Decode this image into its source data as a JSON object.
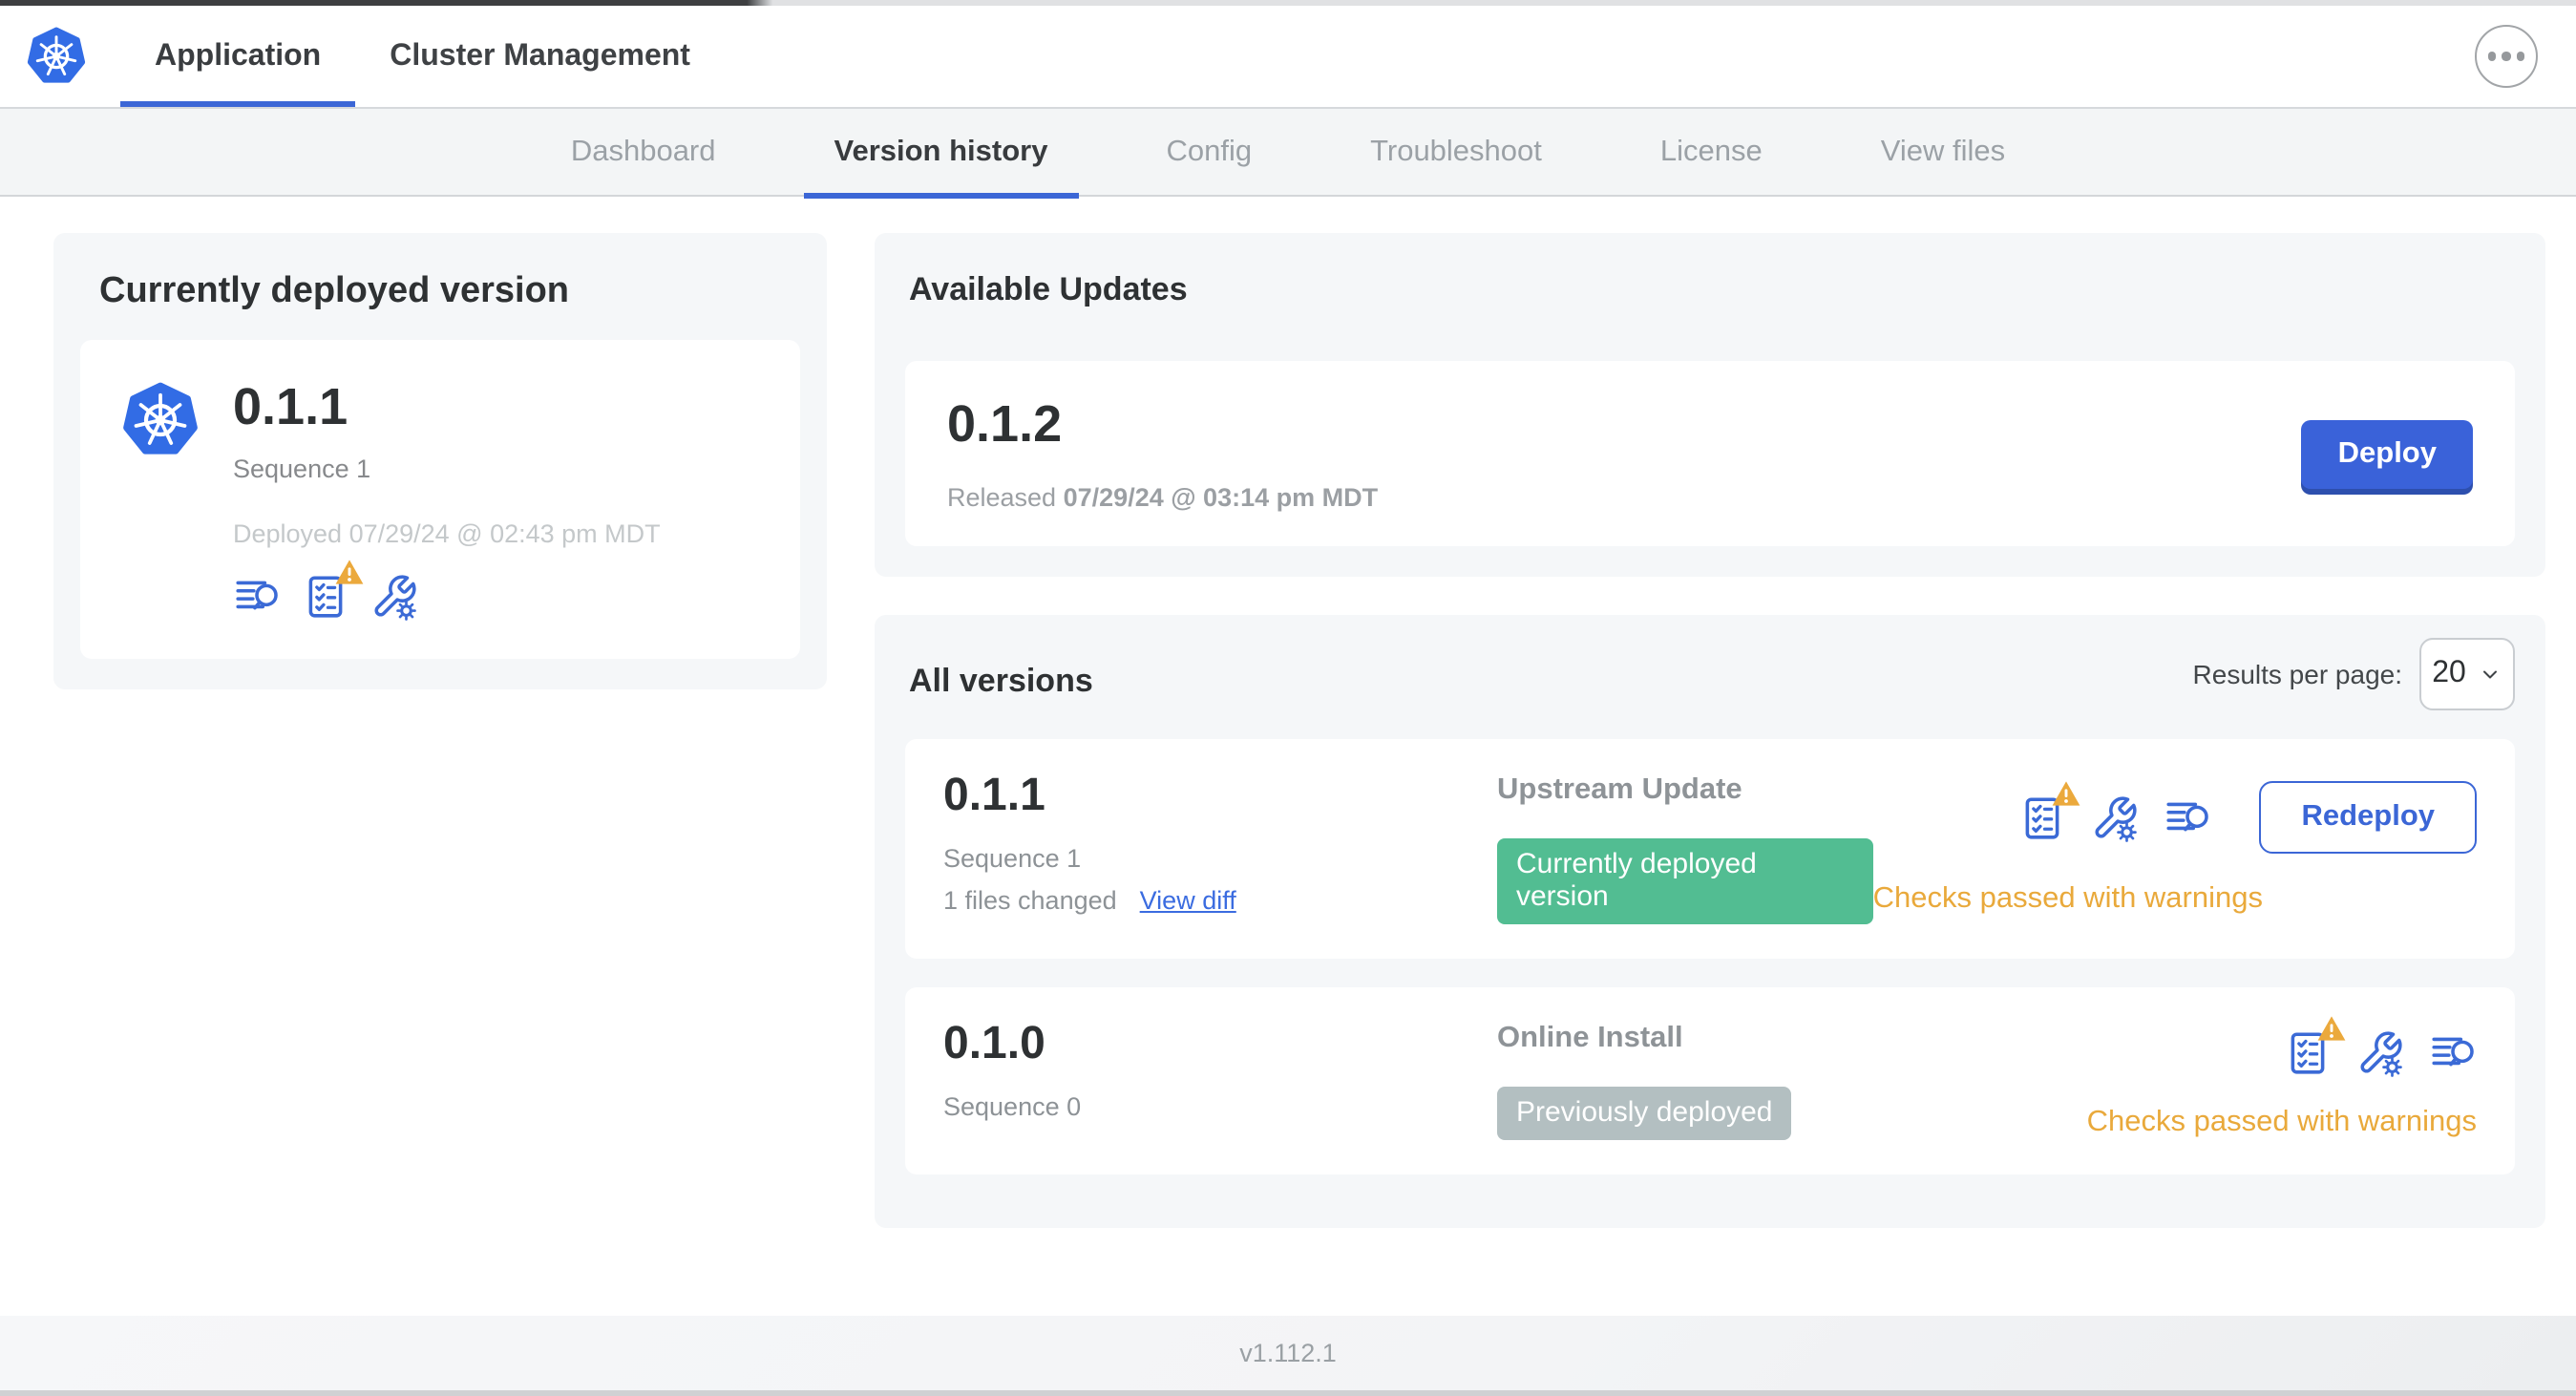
{
  "top_nav": {
    "tabs": [
      {
        "label": "Application",
        "active": true
      },
      {
        "label": "Cluster Management",
        "active": false
      }
    ],
    "more_menu_icon": "ellipsis-icon"
  },
  "sub_nav": {
    "tabs": [
      "Dashboard",
      "Version history",
      "Config",
      "Troubleshoot",
      "License",
      "View files"
    ],
    "active_tab": "Version history"
  },
  "currently_deployed": {
    "title": "Currently deployed version",
    "version": "0.1.1",
    "sequence": "Sequence 1",
    "deployed_at": "Deployed 07/29/24 @ 02:43 pm MDT",
    "icons": [
      "logs-search-icon",
      "preflight-checks-warning-icon",
      "config-tools-icon"
    ]
  },
  "available_updates": {
    "title": "Available Updates",
    "version": "0.1.2",
    "released_prefix": "Released",
    "released_at": "07/29/24 @ 03:14 pm MDT",
    "deploy_label": "Deploy"
  },
  "all_versions": {
    "title": "All versions",
    "results_per_page_label": "Results per page:",
    "results_per_page_value": "20",
    "rows": [
      {
        "version": "0.1.1",
        "sequence": "Sequence 1",
        "files_changed": "1 files changed",
        "view_diff_label": "View diff",
        "source": "Upstream Update",
        "badge": "Currently deployed version",
        "badge_color": "#52bd92",
        "checks_status": "Checks passed with warnings",
        "action_label": "Redeploy",
        "icons": [
          "preflight-checks-warning-icon",
          "config-tools-icon",
          "logs-search-icon"
        ]
      },
      {
        "version": "0.1.0",
        "sequence": "Sequence 0",
        "source": "Online Install",
        "badge": "Previously deployed",
        "badge_color": "#b3bfc1",
        "checks_status": "Checks passed with warnings",
        "icons": [
          "preflight-checks-warning-icon",
          "config-tools-icon",
          "logs-search-icon"
        ]
      }
    ]
  },
  "footer": {
    "app_version": "v1.112.1"
  },
  "colors": {
    "accent_blue": "#3b66d6",
    "kubernetes_blue": "#326ce5",
    "deploy_button": "#3a62d9",
    "badge_green": "#52bd92",
    "badge_gray": "#b3bfc1",
    "warning_amber": "#e9a93b",
    "panel_bg": "#f5f7f9",
    "subnav_bg": "#f3f5f6",
    "heading_text": "#2e3133",
    "muted_text": "#8d9296",
    "faint_text": "#c4c8ca"
  }
}
